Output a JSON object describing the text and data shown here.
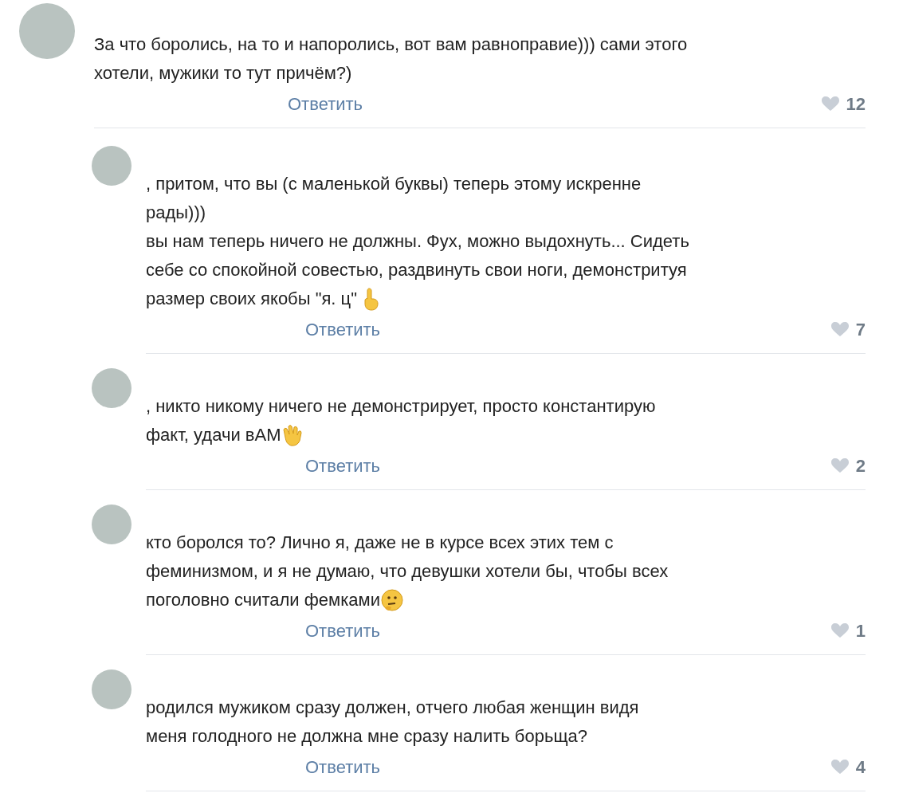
{
  "comments": [
    {
      "reply": false,
      "lines": [
        "За что боролись, на то и напоролись, вот вам равноправие))) сами этого",
        "хотели, мужики то тут причём?)"
      ],
      "kind": "plain",
      "action": "Ответить",
      "likes": "12"
    },
    {
      "reply": true,
      "lines": [
        ", притом, что вы (с маленькой буквы) теперь этому искренне",
        "рады)))",
        "вы нам теперь ничего не должны. Фух, можно выдохнуть... Сидеть",
        "себе со спокойной совестью, раздвинуть свои ноги, демонстритуя",
        "размер своих якобы \"я. ц\""
      ],
      "kind": "finger",
      "action": "Ответить",
      "likes": "7"
    },
    {
      "reply": true,
      "lines": [
        ", никто никому ничего не демонстрирует, просто константирую",
        "факт, удачи вАМ"
      ],
      "kind": "wave",
      "action": "Ответить",
      "likes": "2"
    },
    {
      "reply": true,
      "lines": [
        "кто боролся то? Лично я, даже не в курсе всех этих тем с",
        "феминизмом, и я не думаю, что девушки хотели бы, чтобы всех",
        "поголовно считали фемками"
      ],
      "kind": "thinking",
      "action": "Ответить",
      "likes": "1"
    },
    {
      "reply": true,
      "lines": [
        "родился мужиком сразу должен, отчего любая женщин видя",
        "меня голодного не должна мне сразу налить борьща?"
      ],
      "kind": "plain",
      "action": "Ответить",
      "likes": "4"
    }
  ]
}
